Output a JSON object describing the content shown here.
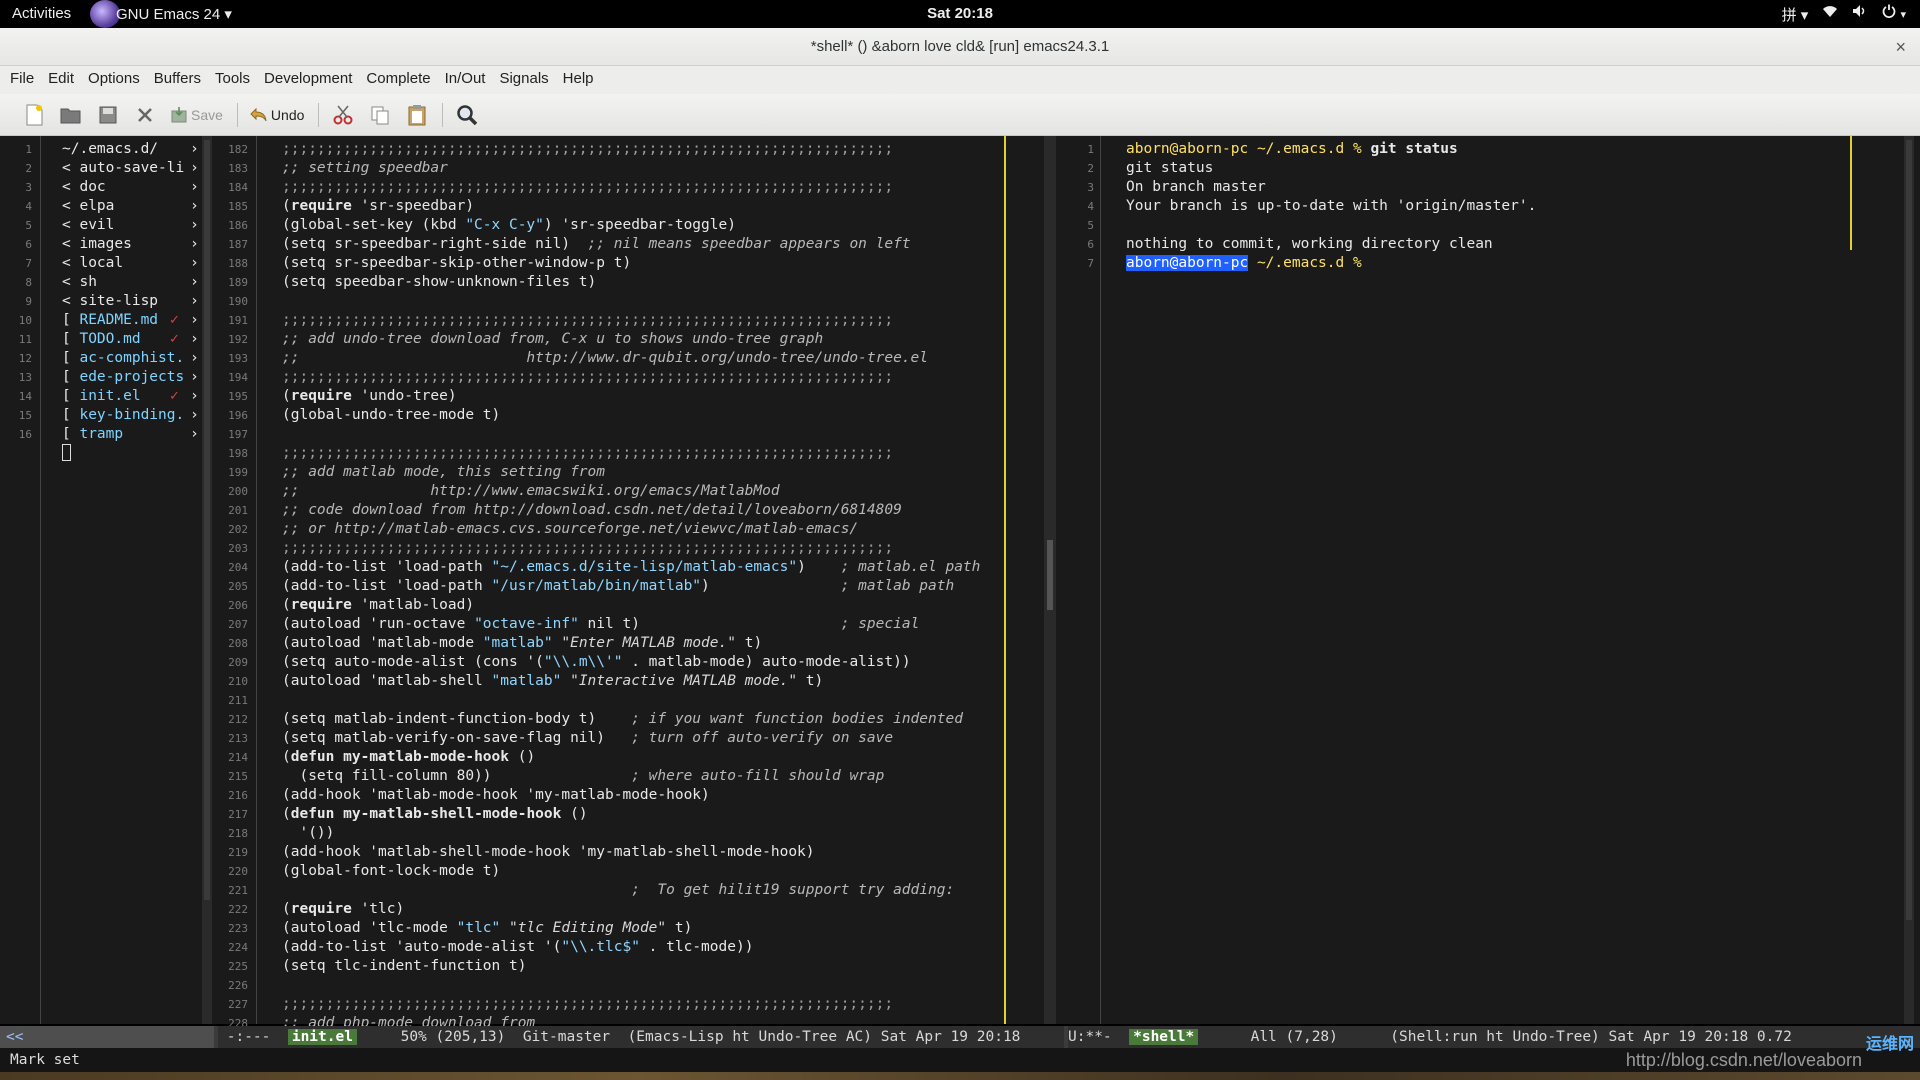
{
  "topbar": {
    "activities": "Activities",
    "app_name": "GNU Emacs 24 ▾",
    "clock": "Sat 20:18",
    "tray": [
      "拼 ▾",
      "wifi-icon",
      "volume-icon",
      "power-icon ▾"
    ]
  },
  "window": {
    "title": "*shell* () &aborn love cld&  [run] emacs24.3.1",
    "close": "×"
  },
  "menu": [
    "File",
    "Edit",
    "Options",
    "Buffers",
    "Tools",
    "Development",
    "Complete",
    "In/Out",
    "Signals",
    "Help"
  ],
  "toolbar": {
    "save_label": "Save",
    "undo_label": "Undo"
  },
  "speedbar": {
    "line_numbers": [
      "1",
      "2",
      "3",
      "4",
      "5",
      "6",
      "7",
      "8",
      "9",
      "10",
      "11",
      "12",
      "13",
      "14",
      "15",
      "16"
    ],
    "items": [
      {
        "mark": "",
        "name": "~/.emacs.d/",
        "kind": "dir"
      },
      {
        "mark": "<",
        "name": "auto-save-li",
        "kind": "dir"
      },
      {
        "mark": "<",
        "name": "doc",
        "kind": "dir"
      },
      {
        "mark": "<",
        "name": "elpa",
        "kind": "dir"
      },
      {
        "mark": "<",
        "name": "evil",
        "kind": "dir"
      },
      {
        "mark": "<",
        "name": "images",
        "kind": "dir"
      },
      {
        "mark": "<",
        "name": "local",
        "kind": "dir"
      },
      {
        "mark": "<",
        "name": "sh",
        "kind": "dir"
      },
      {
        "mark": "<",
        "name": "site-lisp",
        "kind": "dir"
      },
      {
        "mark": "[",
        "name": "README.md",
        "kind": "file",
        "check": "✓"
      },
      {
        "mark": "[",
        "name": "TODO.md",
        "kind": "file",
        "check": "✓"
      },
      {
        "mark": "[",
        "name": "ac-comphist.",
        "kind": "file"
      },
      {
        "mark": "[",
        "name": "ede-projects",
        "kind": "file"
      },
      {
        "mark": "[",
        "name": "init.el",
        "kind": "file",
        "check": "✓"
      },
      {
        "mark": "[",
        "name": "key-binding.",
        "kind": "file"
      },
      {
        "mark": "[",
        "name": "tramp",
        "kind": "file"
      }
    ]
  },
  "code": {
    "line_numbers": [
      "182",
      "183",
      "184",
      "185",
      "186",
      "187",
      "188",
      "189",
      "190",
      "191",
      "192",
      "193",
      "194",
      "195",
      "196",
      "197",
      "198",
      "199",
      "200",
      "201",
      "202",
      "203",
      "204",
      "205",
      "206",
      "207",
      "208",
      "209",
      "210",
      "211",
      "212",
      "213",
      "214",
      "215",
      "216",
      "217",
      "218",
      "219",
      "220",
      "221",
      "222",
      "223",
      "224",
      "225",
      "226",
      "227",
      "228"
    ],
    "lines": [
      ";;;;;;;;;;;;;;;;;;;;;;;;;;;;;;;;;;;;;;;;;;;;;;;;;;;;;;;;;;;;;;;;;;;;;;",
      ";; setting speedbar",
      ";;;;;;;;;;;;;;;;;;;;;;;;;;;;;;;;;;;;;;;;;;;;;;;;;;;;;;;;;;;;;;;;;;;;;;",
      "(require 'sr-speedbar)",
      "(global-set-key (kbd \"C-x C-y\") 'sr-speedbar-toggle)",
      "(setq sr-speedbar-right-side nil)  ;; nil means speedbar appears on left",
      "(setq sr-speedbar-skip-other-window-p t)",
      "(setq speedbar-show-unknown-files t)",
      "",
      ";;;;;;;;;;;;;;;;;;;;;;;;;;;;;;;;;;;;;;;;;;;;;;;;;;;;;;;;;;;;;;;;;;;;;;",
      ";; add undo-tree download from, C-x u to shows undo-tree graph",
      ";;                          http://www.dr-qubit.org/undo-tree/undo-tree.el",
      ";;;;;;;;;;;;;;;;;;;;;;;;;;;;;;;;;;;;;;;;;;;;;;;;;;;;;;;;;;;;;;;;;;;;;;",
      "(require 'undo-tree)",
      "(global-undo-tree-mode t)",
      "",
      ";;;;;;;;;;;;;;;;;;;;;;;;;;;;;;;;;;;;;;;;;;;;;;;;;;;;;;;;;;;;;;;;;;;;;;",
      ";; add matlab mode, this setting from",
      ";;               http://www.emacswiki.org/emacs/MatlabMod",
      ";; code download from http://download.csdn.net/detail/loveaborn/6814809",
      ";; or http://matlab-emacs.cvs.sourceforge.net/viewvc/matlab-emacs/",
      ";;;;;;;;;;;;;;;;;;;;;;;;;;;;;;;;;;;;;;;;;;;;;;;;;;;;;;;;;;;;;;;;;;;;;;",
      "(add-to-list 'load-path \"~/.emacs.d/site-lisp/matlab-emacs\")    ; matlab.el path",
      "(add-to-list 'load-path \"/usr/matlab/bin/matlab\")               ; matlab path",
      "(require 'matlab-load)",
      "(autoload 'run-octave \"octave-inf\" nil t)                       ; special",
      "(autoload 'matlab-mode \"matlab\" \"Enter MATLAB mode.\" t)",
      "(setq auto-mode-alist (cons '(\"\\\\.m\\\\'\" . matlab-mode) auto-mode-alist))",
      "(autoload 'matlab-shell \"matlab\" \"Interactive MATLAB mode.\" t)",
      "",
      "(setq matlab-indent-function-body t)    ; if you want function bodies indented",
      "(setq matlab-verify-on-save-flag nil)   ; turn off auto-verify on save",
      "(defun my-matlab-mode-hook ()",
      "  (setq fill-column 80))                ; where auto-fill should wrap",
      "(add-hook 'matlab-mode-hook 'my-matlab-mode-hook)",
      "(defun my-matlab-shell-mode-hook ()",
      "  '())",
      "(add-hook 'matlab-shell-mode-hook 'my-matlab-shell-mode-hook)",
      "(global-font-lock-mode t)",
      "                                        ;  To get hilit19 support try adding:",
      "(require 'tlc)",
      "(autoload 'tlc-mode \"tlc\" \"tlc Editing Mode\" t)",
      "(add-to-list 'auto-mode-alist '(\"\\\\.tlc$\" . tlc-mode))",
      "(setq tlc-indent-function t)",
      "",
      ";;;;;;;;;;;;;;;;;;;;;;;;;;;;;;;;;;;;;;;;;;;;;;;;;;;;;;;;;;;;;;;;;;;;;;",
      ";; add php-mode download from"
    ]
  },
  "shell": {
    "line_numbers": [
      "1",
      "2",
      "3",
      "4",
      "5",
      "6",
      "7"
    ],
    "prompt_user": "aborn@aborn-pc",
    "prompt_path": " ~/.emacs.d % ",
    "command": "git status",
    "output": [
      "git status",
      "On branch master",
      "Your branch is up-to-date with 'origin/master'.",
      "",
      "nothing to commit, working directory clean"
    ],
    "last_prompt_path": " ~/.emacs.d %"
  },
  "modeline": {
    "speedbar": "<<",
    "code_prefix": " -:---  ",
    "code_buffer": "init.el",
    "code_info": "     50% (205,13)  Git-master  (Emacs-Lisp ht Undo-Tree AC) Sat Apr 19 20:18",
    "shell_prefix": "U:**-  ",
    "shell_buffer": "*shell*",
    "shell_info": "      All (7,28)      (Shell:run ht Undo-Tree) Sat Apr 19 20:18 0.72"
  },
  "echo_area": "Mark set",
  "watermark": {
    "url": "http://blog.csdn.net/loveaborn",
    "logo_text": "运维网"
  }
}
